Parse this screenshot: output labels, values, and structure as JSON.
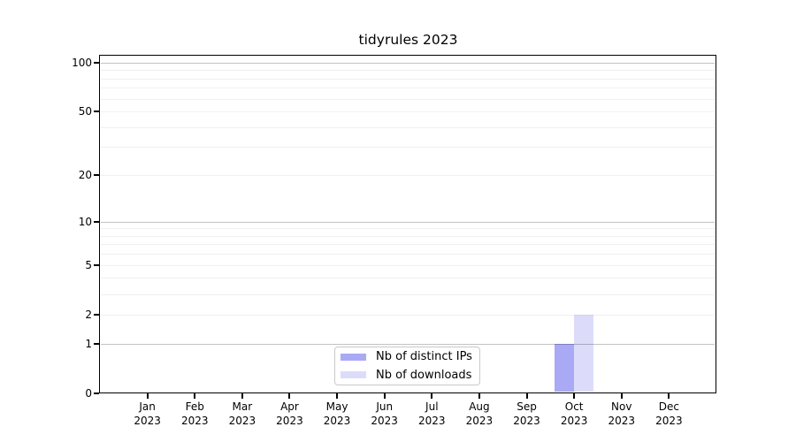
{
  "chart_data": {
    "type": "bar",
    "title": "tidyrules 2023",
    "categories": [
      "Jan",
      "Feb",
      "Mar",
      "Apr",
      "May",
      "Jun",
      "Jul",
      "Aug",
      "Sep",
      "Oct",
      "Nov",
      "Dec"
    ],
    "year": "2023",
    "series": [
      {
        "name": "Nb of distinct IPs",
        "color": "#a9a9f6",
        "values": [
          0,
          0,
          0,
          0,
          0,
          0,
          0,
          0,
          0,
          1,
          0,
          0
        ]
      },
      {
        "name": "Nb of downloads",
        "color": "#dcdcfa",
        "values": [
          0,
          0,
          0,
          0,
          0,
          0,
          0,
          0,
          0,
          2,
          0,
          0
        ]
      }
    ],
    "y_axis": {
      "scale": "log1p",
      "ticks": [
        0,
        1,
        2,
        5,
        10,
        20,
        50,
        100
      ],
      "major_gridlines": [
        1,
        10,
        100
      ],
      "minor_gridlines": [
        2,
        3,
        4,
        5,
        6,
        7,
        8,
        9,
        20,
        30,
        40,
        50,
        60,
        70,
        80,
        90
      ],
      "range_top": 110
    },
    "xlabel": "",
    "ylabel": "",
    "grid": true,
    "legend_position": "bottom-center-inside"
  },
  "legend": {
    "items": [
      {
        "label": "Nb of distinct IPs",
        "color": "#a9a9f6"
      },
      {
        "label": "Nb of downloads",
        "color": "#dcdcfa"
      }
    ]
  }
}
